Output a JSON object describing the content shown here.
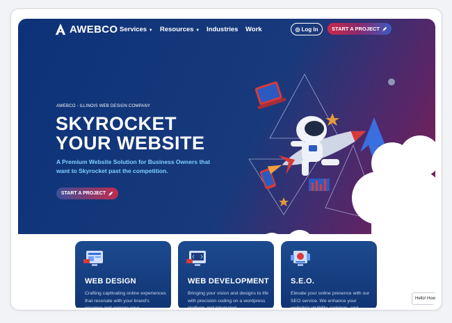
{
  "nav": {
    "logo_text": "AWEBCO",
    "services": "Services",
    "resources": "Resources",
    "industries": "Industries",
    "work": "Work",
    "login": "Log In",
    "start_project": "START A PROJECT"
  },
  "hero": {
    "eyebrow": "AWEBCO - ILLINOIS WEB DESIGN COMPANY",
    "headline_line1": "SKYROCKET",
    "headline_line2": "YOUR WEBSITE",
    "subheadline": "A Premium Website Solution for Business Owners that want to Skyrocket past the competition.",
    "cta": "START A PROJECT"
  },
  "cards": [
    {
      "title": "WEB DESIGN",
      "desc": "Crafting captivating online experiences that resonate with your brand's essence and engage your",
      "icon": "web-design-icon"
    },
    {
      "title": "WEB DEVELOPMENT",
      "desc": "Bringing your vision and designs to life with precision coding on a wordpress platform and integrated",
      "icon": "web-development-icon"
    },
    {
      "title": "S.E.O.",
      "desc": "Elevate your online presence with our SEO service. We enhance your website's visibility, rankings, and",
      "icon": "seo-icon"
    }
  ],
  "chat": {
    "text": "Hello! How c"
  },
  "colors": {
    "hero_start": "#0d3278",
    "hero_end": "#8a1d4b",
    "accent_cyan": "#7fd0ff",
    "cta_red": "#c22b4d"
  }
}
